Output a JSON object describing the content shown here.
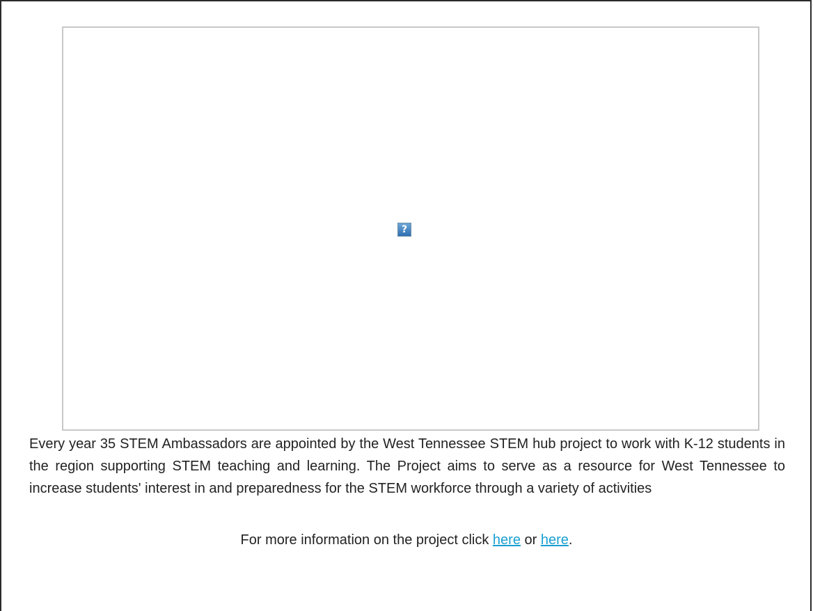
{
  "image_placeholder": {
    "icon": "missing-image-icon",
    "glyph": "?"
  },
  "description": "Every year 35 STEM Ambassadors are appointed by the West Tennessee STEM hub project to work with K-12 students in the region supporting STEM teaching and learning. The Project aims to serve as a resource for West Tennessee to increase students' interest in and preparedness for the STEM workforce through a variety of activities",
  "more_info": {
    "prefix": "For more information on the project click ",
    "link1": "here",
    "separator": " or ",
    "link2": "here",
    "suffix": "."
  },
  "colors": {
    "link": "#1a9fd0",
    "frame": "#2b2b2b",
    "image_border": "#c8c8c8"
  }
}
